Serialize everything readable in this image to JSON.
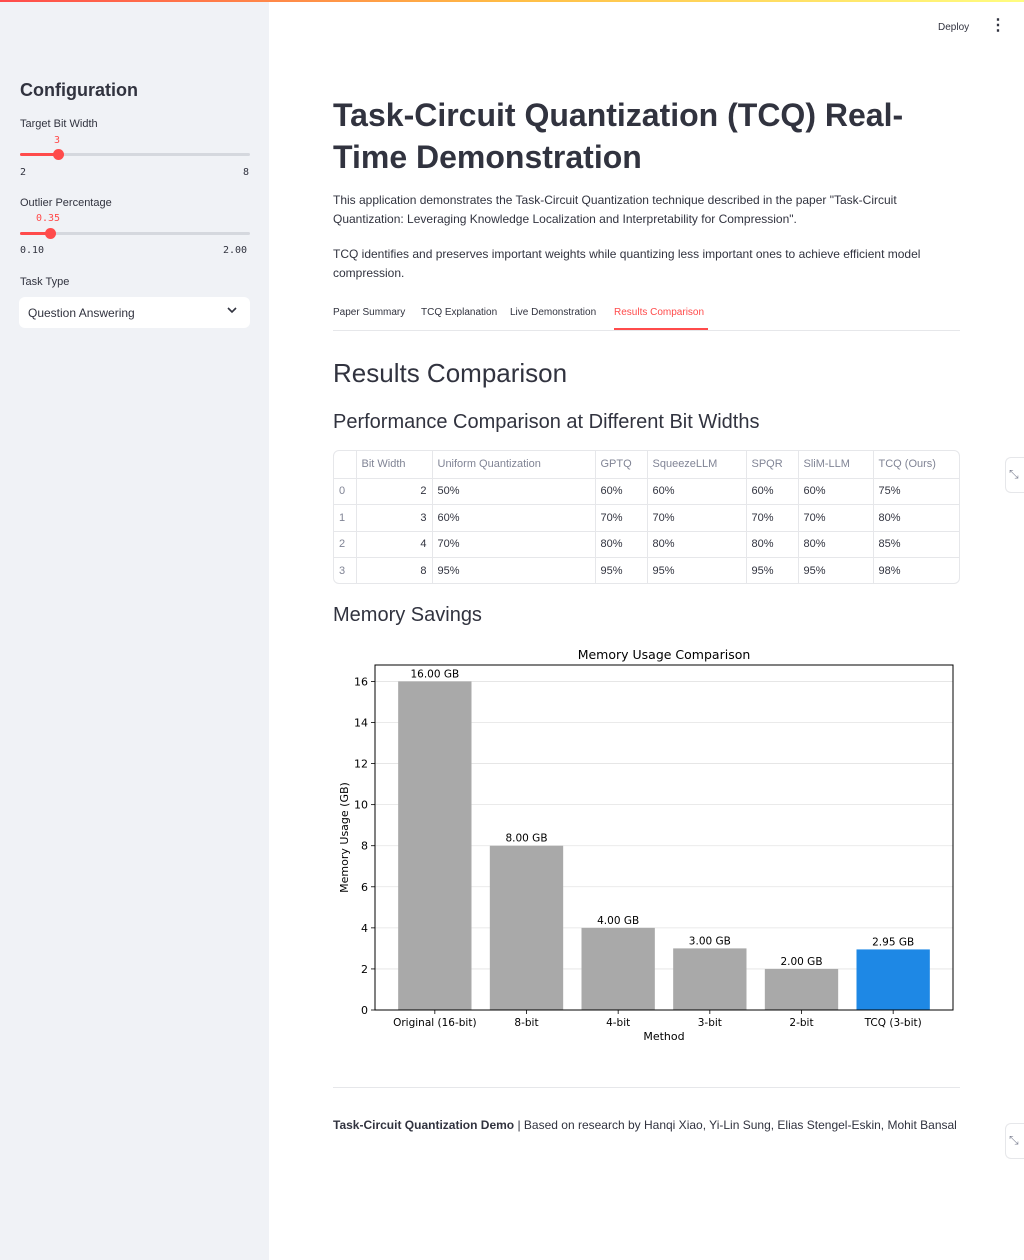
{
  "header": {
    "deploy_label": "Deploy",
    "menu_icon": "⋮"
  },
  "sidebar": {
    "title": "Configuration",
    "bit_width": {
      "label": "Target Bit Width",
      "value": "3",
      "min": "2",
      "max": "8",
      "fraction": 0.1667
    },
    "outlier": {
      "label": "Outlier Percentage",
      "value": "0.35",
      "min": "0.10",
      "max": "2.00",
      "fraction": 0.1316
    },
    "task_type": {
      "label": "Task Type",
      "selected": "Question Answering"
    }
  },
  "main": {
    "title": "Task-Circuit Quantization (TCQ) Real-Time Demonstration",
    "intro_1": "This application demonstrates the Task-Circuit Quantization technique described in the paper \"Task-Circuit Quantization: Leveraging Knowledge Localization and Interpretability for Compression\".",
    "intro_2": "TCQ identifies and preserves important weights while quantizing less important ones to achieve efficient model compression.",
    "tabs": [
      "Paper Summary",
      "TCQ Explanation",
      "Live Demonstration",
      "Results Comparison"
    ],
    "active_tab": "Results Comparison",
    "section_title": "Results Comparison",
    "perf_title": "Performance Comparison at Different Bit Widths",
    "table": {
      "columns": [
        "",
        "Bit Width",
        "Uniform Quantization",
        "GPTQ",
        "SqueezeLLM",
        "SPQR",
        "SliM-LLM",
        "TCQ (Ours)"
      ],
      "rows": [
        [
          "0",
          "2",
          "50%",
          "60%",
          "60%",
          "60%",
          "60%",
          "75%"
        ],
        [
          "1",
          "3",
          "60%",
          "70%",
          "70%",
          "70%",
          "70%",
          "80%"
        ],
        [
          "2",
          "4",
          "70%",
          "80%",
          "80%",
          "80%",
          "80%",
          "85%"
        ],
        [
          "3",
          "8",
          "95%",
          "95%",
          "95%",
          "95%",
          "95%",
          "98%"
        ]
      ]
    },
    "memory_title": "Memory Savings",
    "footer_bold": "Task-Circuit Quantization Demo",
    "footer_rest": " | Based on research by Hanqi Xiao, Yi-Lin Sung, Elias Stengel-Eskin, Mohit Bansal"
  },
  "chart_data": {
    "type": "bar",
    "title": "Memory Usage Comparison",
    "xlabel": "Method",
    "ylabel": "Memory Usage (GB)",
    "categories": [
      "Original (16-bit)",
      "8-bit",
      "4-bit",
      "3-bit",
      "2-bit",
      "TCQ (3-bit)"
    ],
    "values": [
      16.0,
      8.0,
      4.0,
      3.0,
      2.0,
      2.95
    ],
    "data_labels": [
      "16.00 GB",
      "8.00 GB",
      "4.00 GB",
      "3.00 GB",
      "2.00 GB",
      "2.95 GB"
    ],
    "colors": [
      "#a9a9a9",
      "#a9a9a9",
      "#a9a9a9",
      "#a9a9a9",
      "#a9a9a9",
      "#1e88e5"
    ],
    "yticks": [
      0,
      2,
      4,
      6,
      8,
      10,
      12,
      14,
      16
    ],
    "ylim": [
      0,
      16.8
    ],
    "grid": true
  }
}
